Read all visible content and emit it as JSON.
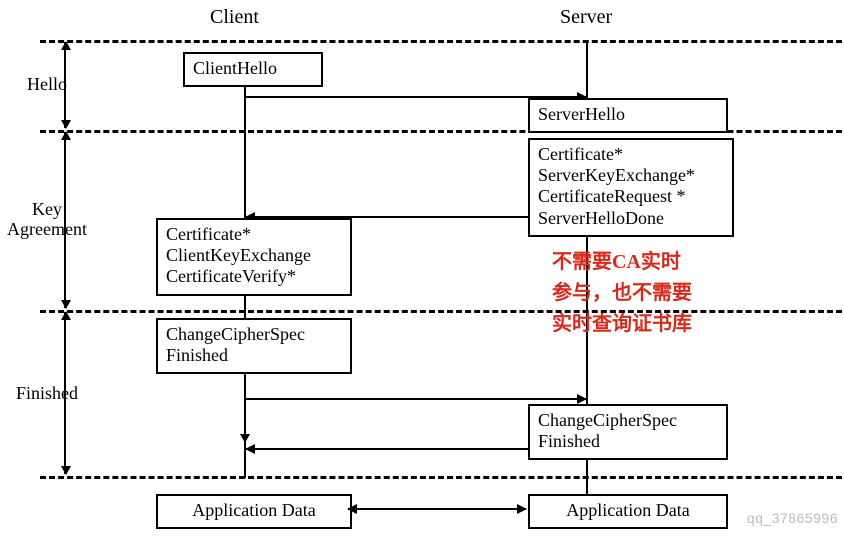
{
  "headers": {
    "client": "Client",
    "server": "Server"
  },
  "phases": {
    "hello": "Hello",
    "key_agreement": "Key\nAgreement",
    "finished": "Finished"
  },
  "messages": {
    "client_hello": {
      "l1": "ClientHello"
    },
    "server_hello": {
      "l1": "ServerHello"
    },
    "server_cert": {
      "l1": "Certificate*",
      "l2": "ServerKeyExchange*",
      "l3": "CertificateRequest *",
      "l4": "ServerHelloDone"
    },
    "client_cert": {
      "l1": "Certificate*",
      "l2": "ClientKeyExchange",
      "l3": "CertificateVerify*"
    },
    "client_ccs": {
      "l1": "ChangeCipherSpec",
      "l2": "Finished"
    },
    "server_ccs": {
      "l1": "ChangeCipherSpec",
      "l2": "Finished"
    },
    "client_appdata": {
      "l1": "Application Data"
    },
    "server_appdata": {
      "l1": "Application Data"
    }
  },
  "annotation": {
    "l1": "不需要CA实时",
    "l2": "参与，也不需要",
    "l3": "实时查询证书库"
  },
  "watermark": "qq_37865996"
}
